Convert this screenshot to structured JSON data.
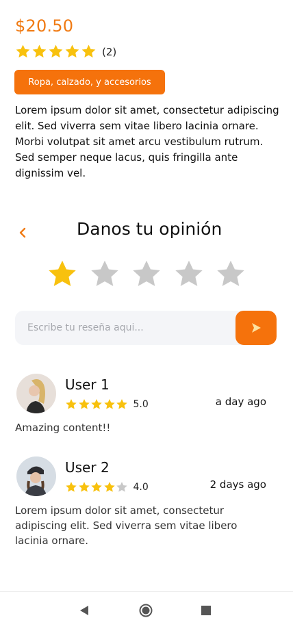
{
  "product": {
    "price": "$20.50",
    "rating_count": "(2)",
    "rating": 5,
    "category": "Ropa, calzado, y accesorios",
    "description": "Lorem ipsum dolor sit amet, consectetur adipiscing elit. Sed viverra sem vitae libero lacinia ornare. Morbi volutpat sit amet arcu vestibulum rutrum. Sed semper neque lacus, quis fringilla ante dignissim vel."
  },
  "opinion": {
    "title": "Danos tu opinión",
    "selected_stars": 1,
    "total_stars": 5,
    "placeholder": "Escribe tu reseña aqui..."
  },
  "reviews": [
    {
      "user": "User 1",
      "stars": 5,
      "score": "5.0",
      "date": "a day ago",
      "text": "Amazing content!!"
    },
    {
      "user": "User 2",
      "stars": 4,
      "score": "4.0",
      "date": "2 days ago",
      "text": "Lorem ipsum dolor sit amet, consectetur adipiscing elit. Sed viverra sem vitae libero lacinia ornare."
    }
  ],
  "colors": {
    "accent": "#f5720c",
    "star_gold": "#f8c10e",
    "star_gray": "#c8c8c8"
  },
  "icons": {
    "back": "chevron-left-icon",
    "send": "send-arrow-icon",
    "nav_back": "triangle-back-icon",
    "nav_home": "circle-home-icon",
    "nav_recent": "square-recent-icon"
  }
}
